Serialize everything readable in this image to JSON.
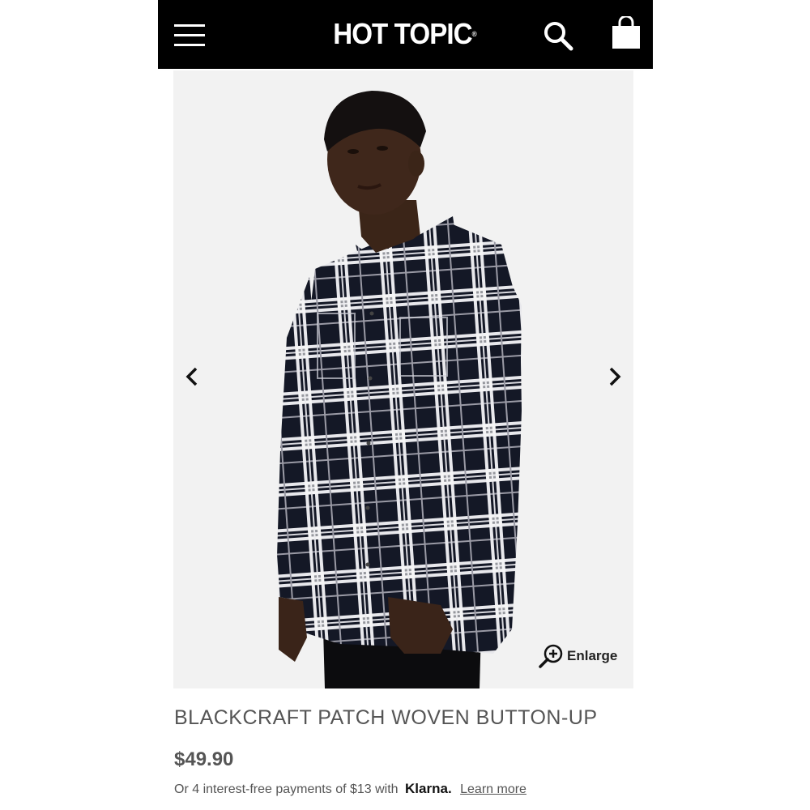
{
  "header": {
    "logo_text": "HOT TOPIC",
    "background": "#000000",
    "menu_icon": "hamburger-menu-icon",
    "search_icon": "search-icon",
    "bag_icon": "shopping-bag-icon"
  },
  "gallery": {
    "prev_icon": "chevron-left-icon",
    "next_icon": "chevron-right-icon",
    "enlarge_label": "Enlarge",
    "enlarge_icon": "zoom-in-icon"
  },
  "product": {
    "title": "BLACKCRAFT PATCH WOVEN BUTTON-UP",
    "price": "$49.90",
    "installments_text": "Or 4 interest-free payments of $13 with",
    "klarna_label": "Klarna.",
    "learn_more_label": "Learn more"
  }
}
